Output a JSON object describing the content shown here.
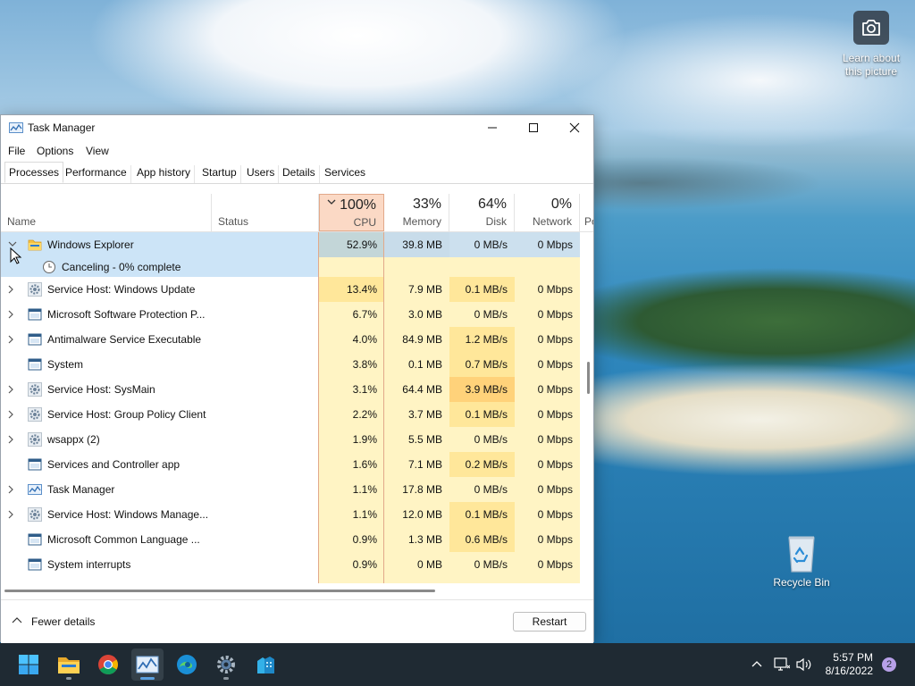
{
  "desktop": {
    "learn_label": "Learn about this picture",
    "recycle_label": "Recycle Bin"
  },
  "window": {
    "title": "Task Manager",
    "menu": [
      "File",
      "Options",
      "View"
    ],
    "tabs": [
      "Processes",
      "Performance",
      "App history",
      "Startup",
      "Users",
      "Details",
      "Services"
    ],
    "active_tab": "Processes"
  },
  "columns": {
    "name": "Name",
    "status": "Status",
    "cpu": {
      "pct": "100%",
      "label": "CPU"
    },
    "memory": {
      "pct": "33%",
      "label": "Memory"
    },
    "disk": {
      "pct": "64%",
      "label": "Disk"
    },
    "network": {
      "pct": "0%",
      "label": "Network"
    },
    "power": "Po"
  },
  "selected": {
    "name": "Windows Explorer",
    "status_text": "Canceling - 0% complete",
    "cpu": "52.9%",
    "memory": "39.8 MB",
    "disk": "0 MB/s",
    "network": "0 Mbps"
  },
  "processes": [
    {
      "name": "Service Host: Windows Update",
      "cpu": "13.4%",
      "memory": "7.9 MB",
      "disk": "0.1 MB/s",
      "network": "0 Mbps",
      "icon": "gear-icon",
      "expandable": true
    },
    {
      "name": "Microsoft Software Protection P...",
      "cpu": "6.7%",
      "memory": "3.0 MB",
      "disk": "0 MB/s",
      "network": "0 Mbps",
      "icon": "app-window-icon",
      "expandable": true
    },
    {
      "name": "Antimalware Service Executable",
      "cpu": "4.0%",
      "memory": "84.9 MB",
      "disk": "1.2 MB/s",
      "network": "0 Mbps",
      "icon": "app-window-icon",
      "expandable": true
    },
    {
      "name": "System",
      "cpu": "3.8%",
      "memory": "0.1 MB",
      "disk": "0.7 MB/s",
      "network": "0 Mbps",
      "icon": "app-window-icon",
      "expandable": false
    },
    {
      "name": "Service Host: SysMain",
      "cpu": "3.1%",
      "memory": "64.4 MB",
      "disk": "3.9 MB/s",
      "network": "0 Mbps",
      "icon": "gear-icon",
      "expandable": true
    },
    {
      "name": "Service Host: Group Policy Client",
      "cpu": "2.2%",
      "memory": "3.7 MB",
      "disk": "0.1 MB/s",
      "network": "0 Mbps",
      "icon": "gear-icon",
      "expandable": true
    },
    {
      "name": "wsappx (2)",
      "cpu": "1.9%",
      "memory": "5.5 MB",
      "disk": "0 MB/s",
      "network": "0 Mbps",
      "icon": "gear-icon",
      "expandable": true
    },
    {
      "name": "Services and Controller app",
      "cpu": "1.6%",
      "memory": "7.1 MB",
      "disk": "0.2 MB/s",
      "network": "0 Mbps",
      "icon": "app-window-icon",
      "expandable": false
    },
    {
      "name": "Task Manager",
      "cpu": "1.1%",
      "memory": "17.8 MB",
      "disk": "0 MB/s",
      "network": "0 Mbps",
      "icon": "task-manager-icon",
      "expandable": true
    },
    {
      "name": "Service Host: Windows Manage...",
      "cpu": "1.1%",
      "memory": "12.0 MB",
      "disk": "0.1 MB/s",
      "network": "0 Mbps",
      "icon": "gear-icon",
      "expandable": true
    },
    {
      "name": "Microsoft Common Language ...",
      "cpu": "0.9%",
      "memory": "1.3 MB",
      "disk": "0.6 MB/s",
      "network": "0 Mbps",
      "icon": "app-window-icon",
      "expandable": false
    },
    {
      "name": "System interrupts",
      "cpu": "0.9%",
      "memory": "0 MB",
      "disk": "0 MB/s",
      "network": "0 Mbps",
      "icon": "app-window-icon",
      "expandable": false
    }
  ],
  "footer": {
    "fewer_details": "Fewer details",
    "restart": "Restart"
  },
  "taskbar": {
    "time": "5:57 PM",
    "date": "8/16/2022",
    "notifications": "2"
  },
  "colors": {
    "heat_light": "#fff4c4",
    "heat_mid": "#ffe79a",
    "heat_high": "#ffd27a",
    "sorted_header": "#fbd9c5",
    "selection": "#cce4f7"
  }
}
